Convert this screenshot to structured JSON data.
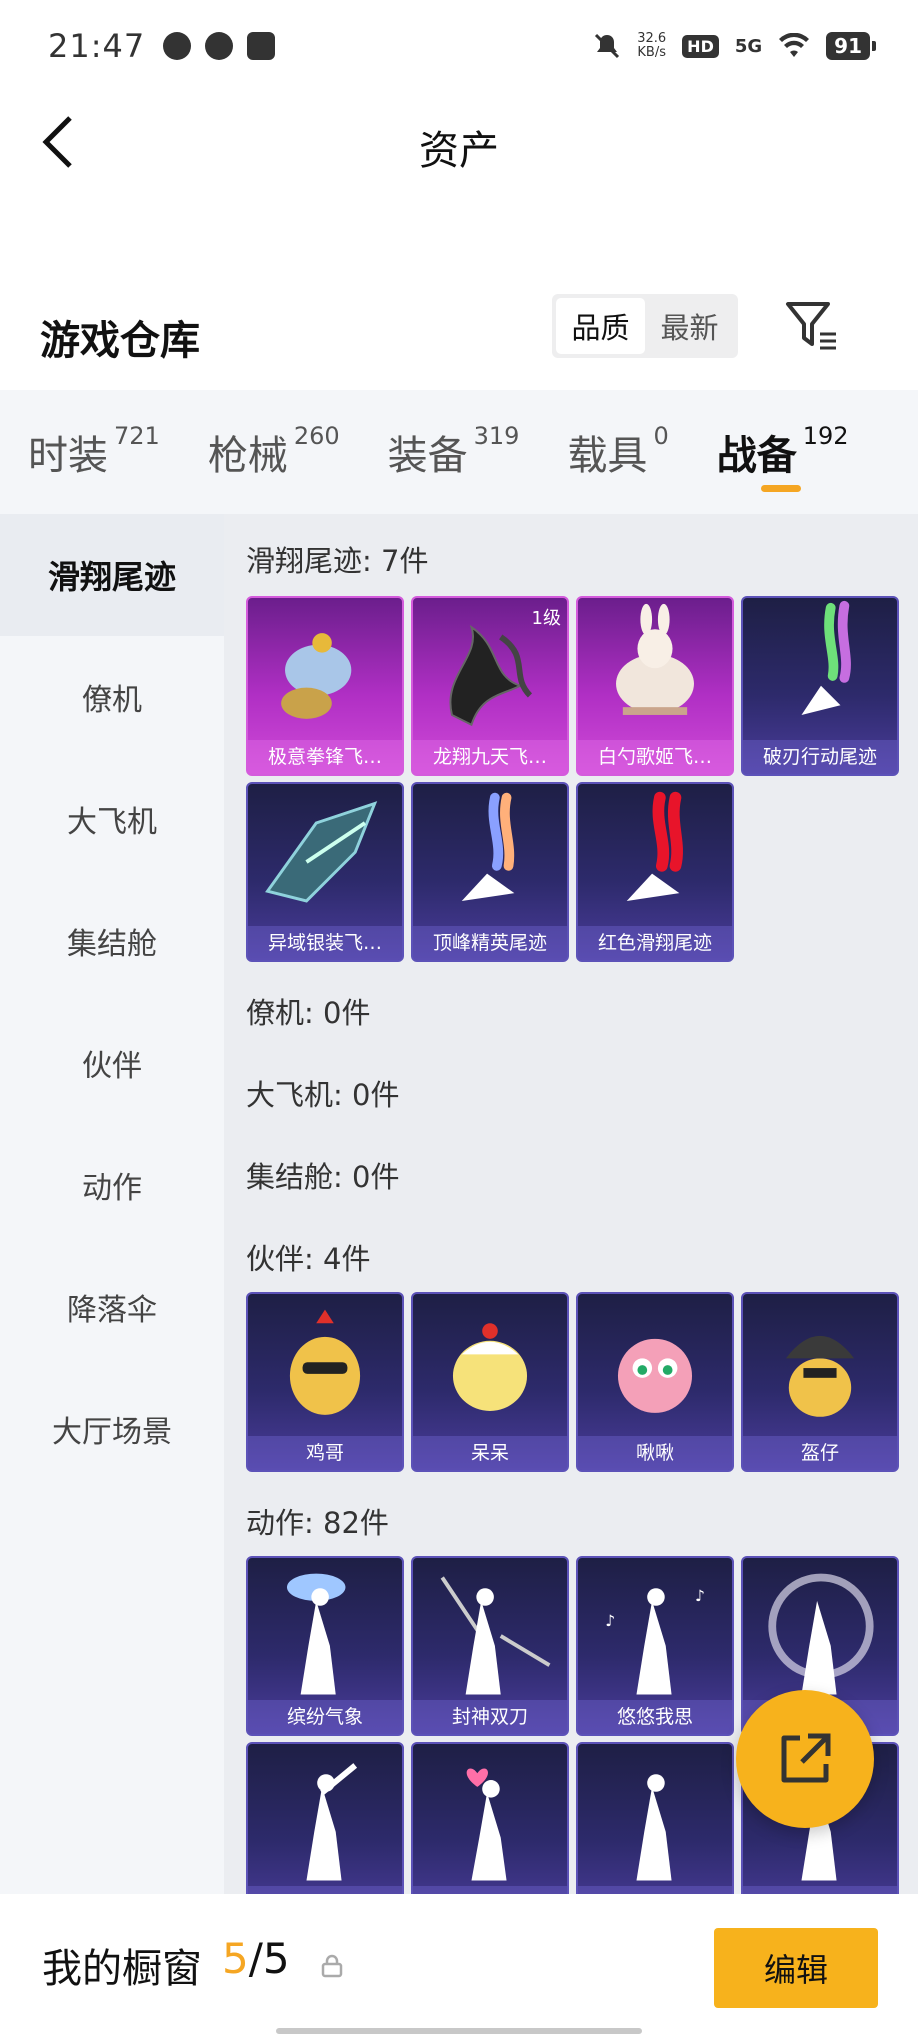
{
  "status_bar": {
    "time": "21:47",
    "net_speed_value": "32.6",
    "net_speed_unit": "KB/s",
    "hd": "HD",
    "network": "5G",
    "battery": "91"
  },
  "nav": {
    "title": "资产",
    "back_icon": "chevron-left-icon"
  },
  "warehouse": {
    "title": "游戏仓库",
    "sort_options": [
      "品质",
      "最新"
    ],
    "sort_selected": "品质",
    "filter_icon": "filter-icon"
  },
  "category_tabs": [
    {
      "label": "时装",
      "count": "721",
      "active": false
    },
    {
      "label": "枪械",
      "count": "260",
      "active": false
    },
    {
      "label": "装备",
      "count": "319",
      "active": false
    },
    {
      "label": "载具",
      "count": "0",
      "active": false
    },
    {
      "label": "战备",
      "count": "192",
      "active": true
    }
  ],
  "side_menu": [
    "滑翔尾迹",
    "僚机",
    "大飞机",
    "集结舱",
    "伙伴",
    "动作",
    "降落伞",
    "大厅场景"
  ],
  "side_menu_active": "滑翔尾迹",
  "sections": {
    "glide_trail": {
      "title": "滑翔尾迹: 7件",
      "items": [
        {
          "name": "极意拳锋飞…",
          "style": "pink",
          "badge": ""
        },
        {
          "name": "龙翔九天飞…",
          "style": "pink",
          "badge": "1级"
        },
        {
          "name": "白勺歌姬飞…",
          "style": "pink",
          "badge": ""
        },
        {
          "name": "破刃行动尾迹",
          "style": "blue",
          "badge": ""
        },
        {
          "name": "异域银装飞…",
          "style": "blue",
          "badge": ""
        },
        {
          "name": "顶峰精英尾迹",
          "style": "blue",
          "badge": ""
        },
        {
          "name": "红色滑翔尾迹",
          "style": "blue",
          "badge": ""
        }
      ]
    },
    "wingman": {
      "title": "僚机: 0件"
    },
    "big_plane": {
      "title": "大飞机: 0件"
    },
    "rally_pod": {
      "title": "集结舱: 0件"
    },
    "partner": {
      "title": "伙伴: 4件",
      "items": [
        {
          "name": "鸡哥",
          "style": "blue"
        },
        {
          "name": "呆呆",
          "style": "blue"
        },
        {
          "name": "啾啾",
          "style": "blue"
        },
        {
          "name": "盔仔",
          "style": "blue"
        }
      ]
    },
    "emote": {
      "title": "动作: 82件",
      "items": [
        {
          "name": "缤纷气象",
          "style": "blue"
        },
        {
          "name": "封神双刀",
          "style": "blue"
        },
        {
          "name": "悠悠我思",
          "style": "blue"
        },
        {
          "name": "",
          "style": "blue"
        },
        {
          "name": "",
          "style": "blue"
        },
        {
          "name": "",
          "style": "blue"
        },
        {
          "name": "",
          "style": "blue"
        },
        {
          "name": "",
          "style": "blue"
        }
      ]
    }
  },
  "fab_icon": "share-external-icon",
  "bottom_bar": {
    "label": "我的橱窗",
    "current": "5",
    "separator": "/",
    "total": "5",
    "lock_icon": "lock-icon",
    "edit_label": "编辑"
  }
}
